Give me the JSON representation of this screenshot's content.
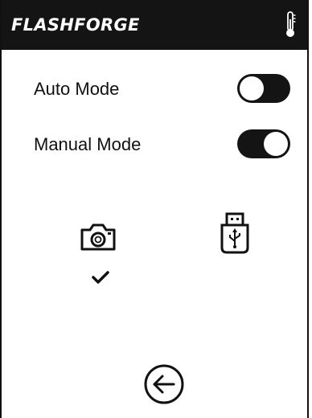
{
  "header": {
    "brand": "FLASHFORGE",
    "status_icon": "thermometer-icon"
  },
  "modes": [
    {
      "label": "Auto Mode",
      "state": "off"
    },
    {
      "label": "Manual Mode",
      "state": "on"
    }
  ],
  "sources": [
    {
      "icon": "camera-icon",
      "selected": true
    },
    {
      "icon": "usb-drive-icon",
      "selected": false
    }
  ],
  "footer": {
    "back_icon": "back-arrow-icon"
  },
  "colors": {
    "header_bg": "#141414",
    "toggle_bg": "#141414",
    "icon": "#111111",
    "background": "#ffffff"
  }
}
